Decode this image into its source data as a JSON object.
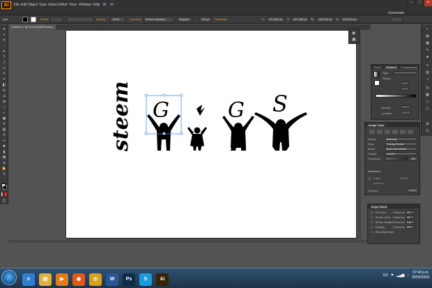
{
  "app": {
    "logo": "Ai",
    "workspace": "Essentials"
  },
  "menu": [
    "File",
    "Edit",
    "Object",
    "Type",
    "Select",
    "Effect",
    "View",
    "Window",
    "Help"
  ],
  "menu_extra": [
    "Br",
    "St"
  ],
  "control_bar": {
    "label_left": "Type",
    "stroke_label": "Stroke",
    "opacity_label": "Opacity",
    "opacity_value": "100%",
    "character_label": "Character",
    "font_family": "Bodoni Stardust",
    "font_style": "Regular",
    "font_size": "120 pt",
    "paragraph_label": "Paragraph",
    "x_value": "479,652 pt",
    "y_value": "497,085 pt",
    "w_value": "105,764 pt",
    "h_value": "225,751 pt"
  },
  "document": {
    "tab_title": "Untitled-1* @ 61% (RGB/Preview)"
  },
  "artwork": {
    "letters": [
      "G",
      "G",
      "S"
    ],
    "vertical_text": "steem"
  },
  "gradient_panel": {
    "tabs": [
      "Stroke",
      "Gradient",
      "Transparency"
    ],
    "type_label": "Type",
    "stroke_label": "Stroke",
    "opacity_label": "Opacity",
    "location_label": "Location"
  },
  "image_trace_panel": {
    "title": "Image Trace",
    "rows": [
      {
        "label": "Preset",
        "value": "[Default]"
      },
      {
        "label": "View",
        "value": "Tracing Result"
      },
      {
        "label": "Mode",
        "value": "Black and White"
      },
      {
        "label": "Palette",
        "value": "Limited"
      },
      {
        "label": "Threshold",
        "value": "128"
      }
    ],
    "advanced_label": "Advanced",
    "paths_label": "Paths",
    "anchors_label": "Anchors",
    "colors_label": "Colors",
    "preview_label": "Preview",
    "trace_button": "Trace"
  },
  "magic_wand_panel": {
    "title": "Magic Wand",
    "rows": [
      {
        "label": "Fill Color",
        "tolerance_label": "Tolerance",
        "value": "32",
        "checked": true
      },
      {
        "label": "Stroke Color",
        "tolerance_label": "Tolerance",
        "value": "32",
        "checked": false
      },
      {
        "label": "Stroke Weight",
        "tolerance_label": "Tolerance",
        "value": "5 pt",
        "checked": false
      },
      {
        "label": "Opacity",
        "tolerance_label": "Tolerance",
        "value": "5%",
        "checked": false
      },
      {
        "label": "Blending Mode",
        "tolerance_label": "",
        "value": "",
        "checked": false
      }
    ]
  },
  "taskbar": {
    "apps": [
      {
        "name": "ie-icon",
        "glyph": "e",
        "color": "#2f7fd0"
      },
      {
        "name": "folder-icon",
        "glyph": "▤",
        "color": "#e0b040"
      },
      {
        "name": "media-player-icon",
        "glyph": "▶",
        "color": "#e07b1a"
      },
      {
        "name": "firefox-icon",
        "glyph": "◉",
        "color": "#e05a1a"
      },
      {
        "name": "chrome-icon",
        "glyph": "◎",
        "color": "#d8a020"
      },
      {
        "name": "word-icon",
        "glyph": "W",
        "color": "#2b5797"
      },
      {
        "name": "photoshop-icon",
        "glyph": "Ps",
        "color": "#0e2a4a"
      },
      {
        "name": "skype-icon",
        "glyph": "S",
        "color": "#1a9be0"
      },
      {
        "name": "illustrator-icon",
        "glyph": "Ai",
        "color": "#3a2304"
      }
    ],
    "language": "ES",
    "time": "07:40 p.m.",
    "date": "20/05/2018"
  },
  "colors": {
    "accent": "#ff9a00",
    "canvas_bg": "#535353",
    "selection": "#4a90e2"
  }
}
